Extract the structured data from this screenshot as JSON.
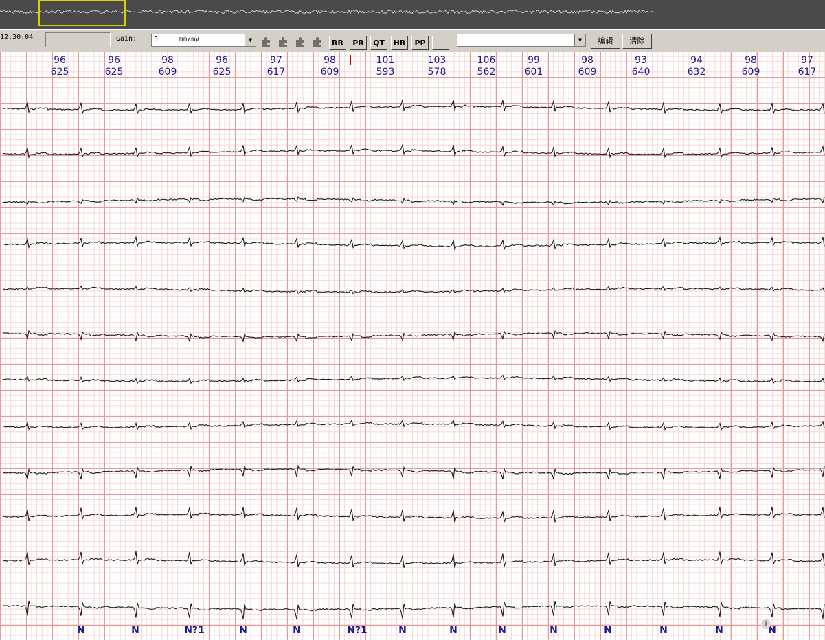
{
  "overview": {
    "window_label": ""
  },
  "toolbar": {
    "time": "12:30:04",
    "gain_label": "Gain:",
    "gain_value": "5     mm/mV",
    "buttons": [
      "RR",
      "PR",
      "QT",
      "HR",
      "PP"
    ],
    "secondary_select_value": "",
    "edit_label": "编辑",
    "clear_label": "清除"
  },
  "beats": [
    {
      "hr": "96",
      "rr": "625"
    },
    {
      "hr": "96",
      "rr": "625"
    },
    {
      "hr": "98",
      "rr": "609"
    },
    {
      "hr": "96",
      "rr": "625"
    },
    {
      "hr": "97",
      "rr": "617"
    },
    {
      "hr": "98",
      "rr": "609"
    },
    {
      "hr": "101",
      "rr": "593"
    },
    {
      "hr": "103",
      "rr": "578"
    },
    {
      "hr": "106",
      "rr": "562"
    },
    {
      "hr": "99",
      "rr": "601"
    },
    {
      "hr": "98",
      "rr": "609"
    },
    {
      "hr": "93",
      "rr": "640"
    },
    {
      "hr": "94",
      "rr": "632"
    },
    {
      "hr": "98",
      "rr": "609"
    },
    {
      "hr": "97",
      "rr": "617"
    }
  ],
  "annotations": [
    "N",
    "N",
    "N?1",
    "N",
    "N",
    "N?1",
    "N",
    "N",
    "N",
    "N",
    "N",
    "N",
    "N",
    "N"
  ],
  "leads_count": 12,
  "colors": {
    "grid_major": "#e79a9a",
    "grid_minor": "#f6d6d6",
    "trace": "#1a1a1a",
    "label_text": "#1a1a8c",
    "overview_bg": "#4a4a4a",
    "overview_window": "#d8d000"
  }
}
